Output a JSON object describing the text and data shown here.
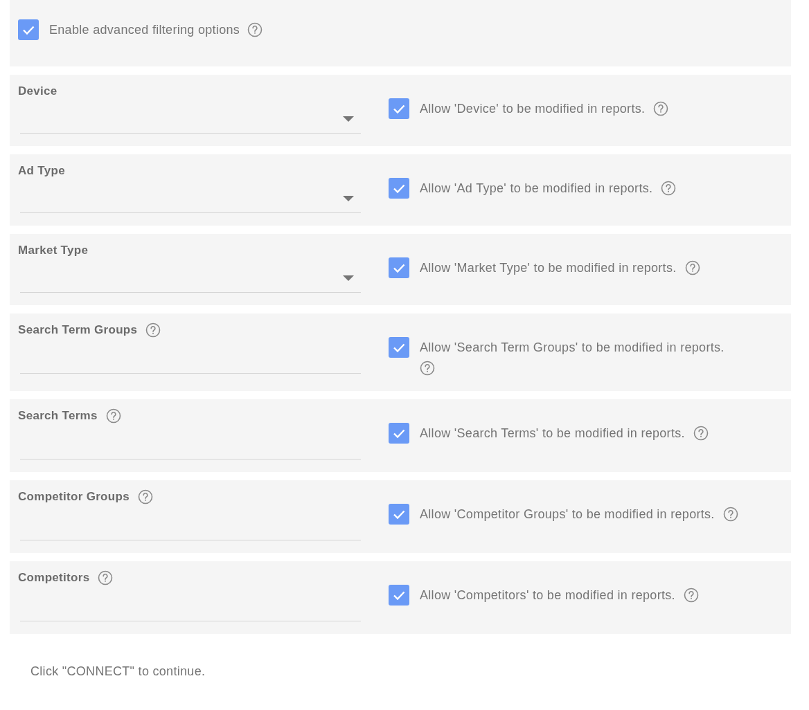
{
  "advanced": {
    "label": "Enable advanced filtering options",
    "checked": true
  },
  "filters": [
    {
      "label": "Device",
      "kind": "dropdown",
      "label_help": false,
      "allow_label": "Allow 'Device' to be modified in reports.",
      "allow_checked": true
    },
    {
      "label": "Ad Type",
      "kind": "dropdown",
      "label_help": false,
      "allow_label": "Allow 'Ad Type' to be modified in reports.",
      "allow_checked": true
    },
    {
      "label": "Market Type",
      "kind": "dropdown",
      "label_help": false,
      "allow_label": "Allow 'Market Type' to be modified in reports.",
      "allow_checked": true
    },
    {
      "label": "Search Term Groups",
      "kind": "text",
      "label_help": true,
      "allow_label": "Allow 'Search Term Groups' to be modified in reports.",
      "allow_checked": true
    },
    {
      "label": "Search Terms",
      "kind": "text",
      "label_help": true,
      "allow_label": "Allow 'Search Terms' to be modified in reports.",
      "allow_checked": true
    },
    {
      "label": "Competitor Groups",
      "kind": "text",
      "label_help": true,
      "allow_label": "Allow 'Competitor Groups' to be modified in reports.",
      "allow_checked": true
    },
    {
      "label": "Competitors",
      "kind": "text",
      "label_help": true,
      "allow_label": "Allow 'Competitors' to be modified in reports.",
      "allow_checked": true
    }
  ],
  "footer": "Click \"CONNECT\" to continue."
}
